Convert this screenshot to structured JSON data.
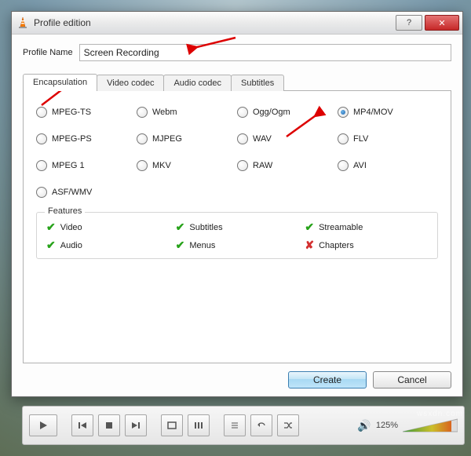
{
  "window": {
    "title": "Profile edition",
    "help_glyph": "?",
    "close_glyph": "✕"
  },
  "profile": {
    "name_label": "Profile Name",
    "name_value": "Screen Recording"
  },
  "tabs": {
    "encapsulation": "Encapsulation",
    "video_codec": "Video codec",
    "audio_codec": "Audio codec",
    "subtitles": "Subtitles"
  },
  "formats": {
    "mpeg_ts": "MPEG-TS",
    "webm": "Webm",
    "ogg": "Ogg/Ogm",
    "mp4": "MP4/MOV",
    "mpeg_ps": "MPEG-PS",
    "mjpeg": "MJPEG",
    "wav": "WAV",
    "flv": "FLV",
    "mpeg1": "MPEG 1",
    "mkv": "MKV",
    "raw": "RAW",
    "avi": "AVI",
    "asf": "ASF/WMV"
  },
  "features": {
    "legend": "Features",
    "video": "Video",
    "subtitles": "Subtitles",
    "streamable": "Streamable",
    "audio": "Audio",
    "menus": "Menus",
    "chapters": "Chapters"
  },
  "buttons": {
    "create": "Create",
    "cancel": "Cancel"
  },
  "player": {
    "volume_pct": "125%"
  }
}
